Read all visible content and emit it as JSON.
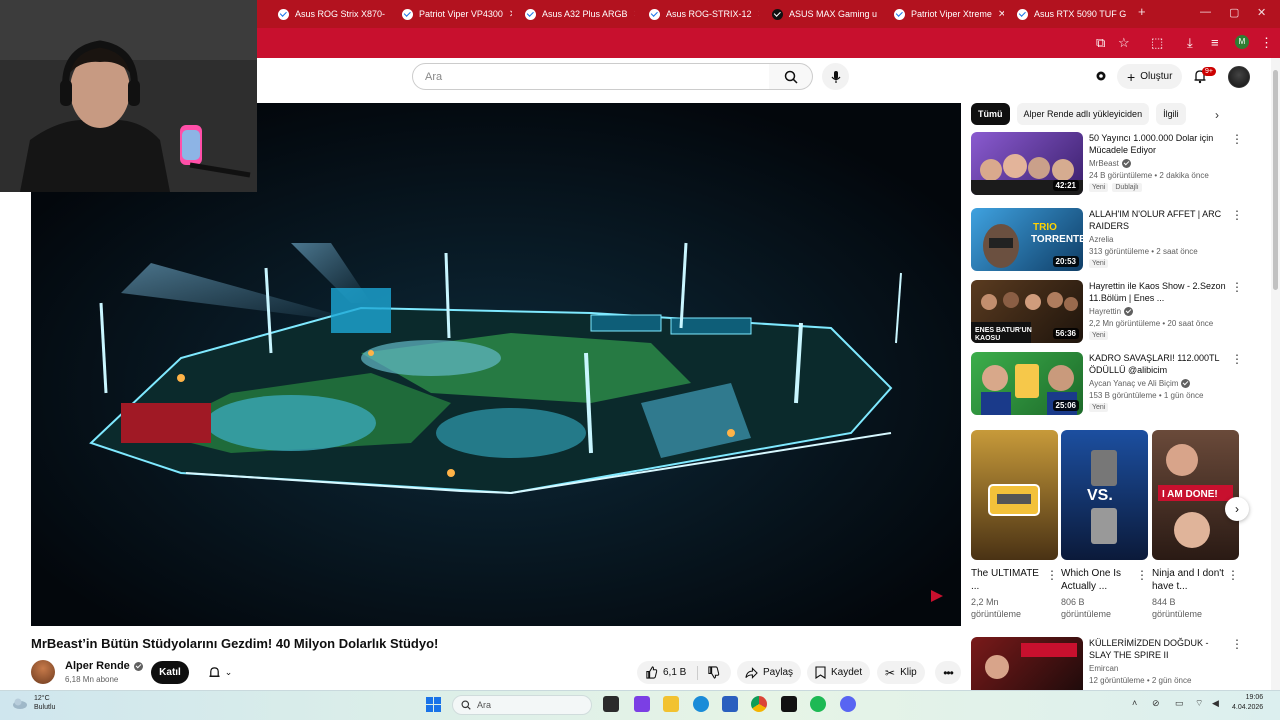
{
  "browser": {
    "tabs": [
      {
        "label": "Asus ROG Strix X870-"
      },
      {
        "label": "Patriot Viper VP4300"
      },
      {
        "label": "Asus A32 Plus ARGB"
      },
      {
        "label": "Asus ROG-STRIX-12"
      },
      {
        "label": "ASUS MAX Gaming u"
      },
      {
        "label": "Patriot Viper Xtreme"
      },
      {
        "label": "Asus RTX 5090 TUF G"
      }
    ],
    "new_tab": "+",
    "profile_initial": "M"
  },
  "youtube": {
    "search_placeholder": "Ara",
    "create_label": "Oluştur",
    "notif_count": "9+"
  },
  "video": {
    "title": "MrBeast’in Bütün Stüdyolarını Gezdim! 40 Milyon Dolarlık Stüdyo!",
    "channel": "Alper Rende",
    "subscribers": "6,18 Mn abone",
    "join_label": "Katıl",
    "like_count": "6,1 B",
    "share_label": "Paylaş",
    "save_label": "Kaydet",
    "clip_label": "Klip"
  },
  "sidebar": {
    "chips": [
      {
        "label": "Tümü",
        "active": true
      },
      {
        "label": "Alper Rende adlı yükleyiciden"
      },
      {
        "label": "İlgili"
      }
    ],
    "recommendations": [
      {
        "title": "50 Yayıncı 1.000.000 Dolar için Mücadele Ediyor",
        "channel": "MrBeast",
        "verified": true,
        "stats": "24 B görüntüleme • 2 dakika önce",
        "badges": [
          "Yeni",
          "Dublajlı"
        ],
        "duration": "42:21",
        "color": "#6a3fa0"
      },
      {
        "title": "ALLAH'IM N'OLUR AFFET | ARC RAIDERS",
        "channel": "Azrelia",
        "verified": false,
        "stats": "313 görüntüleme • 2 saat önce",
        "badges": [
          "Yeni"
        ],
        "duration": "20:53",
        "color": "#1e6fa8"
      },
      {
        "title": "Hayrettin ile Kaos Show - 2.Sezon 11.Bölüm | Enes ...",
        "channel": "Hayrettin",
        "verified": true,
        "stats": "2,2 Mn görüntüleme • 20 saat önce",
        "badges": [
          "Yeni"
        ],
        "duration": "56:36",
        "color": "#3a2a1e"
      },
      {
        "title": "KADRO SAVAŞLARI! 112.000TL ÖDÜLLÜ @alibicim",
        "channel": "Aycan Yanaç ve Ali Biçim",
        "verified": true,
        "stats": "153 B görüntüleme • 1 gün önce",
        "badges": [
          "Yeni"
        ],
        "duration": "25:06",
        "color": "#2f7d3b"
      }
    ],
    "shorts": [
      {
        "title": "The ULTIMATE ...",
        "views": "2,2 Mn görüntüleme"
      },
      {
        "title": "Which One Is Actually ...",
        "views": "806 B görüntüleme"
      },
      {
        "title": "Ninja and I don't have t...",
        "views": "844 B görüntüleme"
      }
    ],
    "last_recommendation": {
      "title": "KÜLLERİMİZDEN DOĞDUK - SLAY THE SPIRE II",
      "channel": "Emircan",
      "stats": "12 görüntüleme • 2 gün önce"
    }
  },
  "taskbar": {
    "weather_temp": "12°C",
    "weather_desc": "Bulutlu",
    "search_placeholder": "Ara",
    "time": "19:06",
    "date": "4.04.2026"
  }
}
